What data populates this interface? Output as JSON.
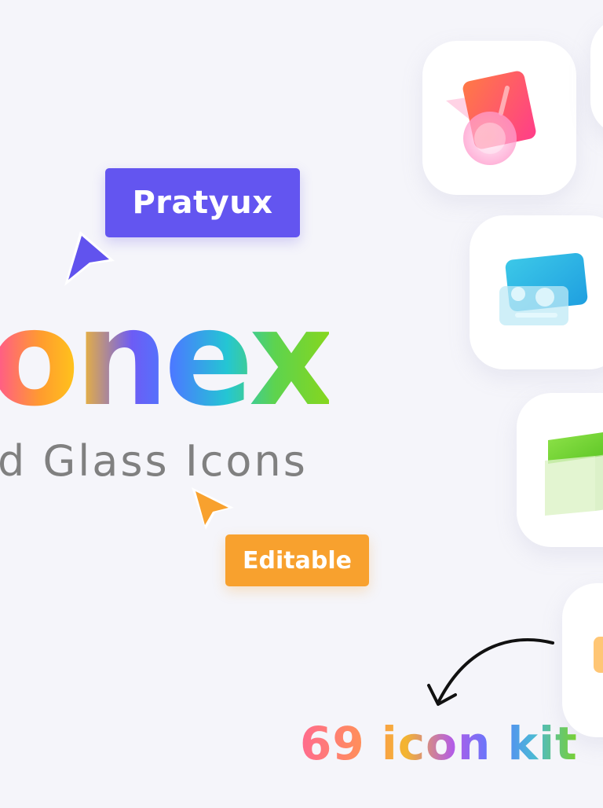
{
  "badges": {
    "author": "Pratyux",
    "editable": "Editable"
  },
  "heading": {
    "brand": "onex",
    "subtitle": "d Glass Icons"
  },
  "kit": {
    "label": "69 icon kit"
  },
  "colors": {
    "background": "#f5f5fa",
    "purple": "#6355f0",
    "orange": "#f8a12e",
    "subtitle": "#808080"
  },
  "icons": [
    "medal-icon",
    "id-card-icon",
    "book-icon",
    "partial-orange-icon"
  ]
}
